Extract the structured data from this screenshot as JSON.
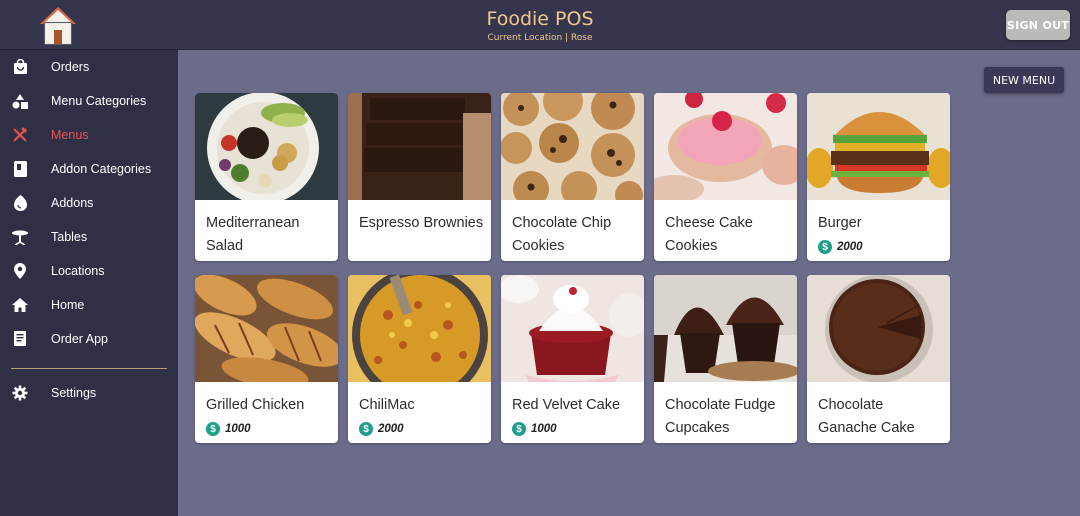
{
  "header": {
    "title": "Foodie POS",
    "location_line": "Current Location | Rose",
    "signout_label": "SIGN OUT"
  },
  "sidebar": {
    "items": [
      {
        "label": "Orders",
        "icon": "shopping-bag-icon"
      },
      {
        "label": "Menu Categories",
        "icon": "category-shapes-icon"
      },
      {
        "label": "Menus",
        "icon": "utensils-icon",
        "active": true
      },
      {
        "label": "Addon Categories",
        "icon": "book-icon"
      },
      {
        "label": "Addons",
        "icon": "egg-icon"
      },
      {
        "label": "Tables",
        "icon": "table-icon"
      },
      {
        "label": "Locations",
        "icon": "location-pin-icon"
      },
      {
        "label": "Home",
        "icon": "home-icon"
      },
      {
        "label": "Order App",
        "icon": "receipt-icon"
      },
      {
        "label": "Settings",
        "icon": "gear-icon"
      }
    ],
    "active_color": "#e8554e"
  },
  "main": {
    "new_menu_label": "NEW MENU",
    "menus": [
      {
        "name": "Mediterranean Salad",
        "price": ""
      },
      {
        "name": "Espresso Brownies",
        "price": ""
      },
      {
        "name": "Chocolate Chip Cookies",
        "price": ""
      },
      {
        "name": "Cheese Cake Cookies",
        "price": ""
      },
      {
        "name": "Burger",
        "price": "2000"
      },
      {
        "name": "Grilled Chicken",
        "price": "1000"
      },
      {
        "name": "ChiliMac",
        "price": "2000"
      },
      {
        "name": "Red Velvet Cake",
        "price": "1000"
      },
      {
        "name": "Chocolate Fudge Cupcakes",
        "price": ""
      },
      {
        "name": "Chocolate Ganache Cake",
        "price": ""
      }
    ],
    "price_icon": "dollar-coin-icon",
    "price_icon_color": "#1f9e8c"
  }
}
